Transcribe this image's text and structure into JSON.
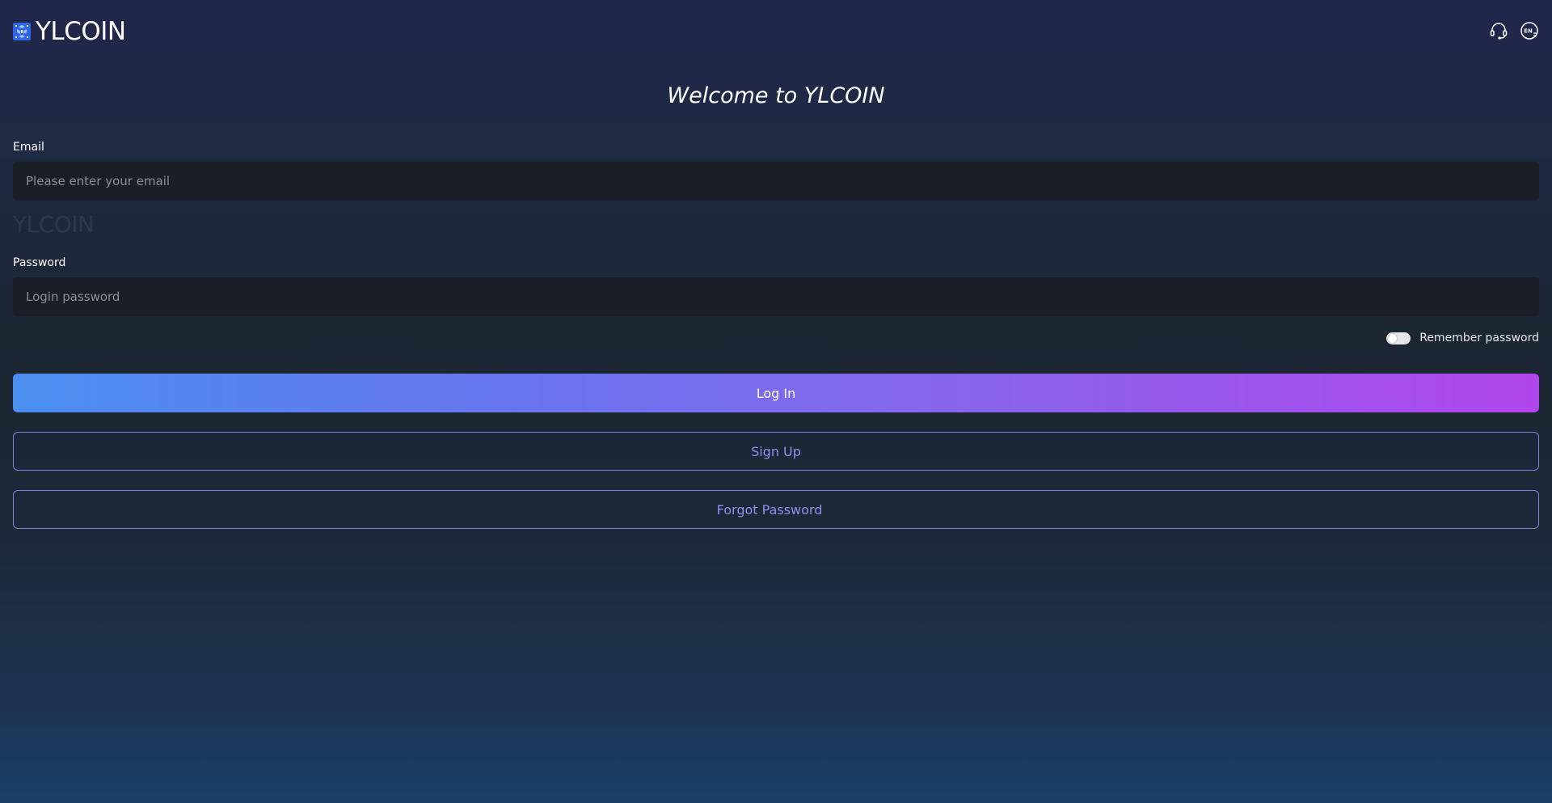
{
  "brand": {
    "name": "YLCOIN",
    "watermark": "YLCOIN"
  },
  "header": {
    "icons": [
      "headset-support-icon",
      "language-en-icon"
    ],
    "language_badge": "EN"
  },
  "welcome": "Welcome to YLCOIN",
  "form": {
    "email": {
      "label": "Email",
      "placeholder": "Please enter your email",
      "value": ""
    },
    "password": {
      "label": "Password",
      "placeholder": "Login password",
      "value": ""
    },
    "remember": {
      "label": "Remember password",
      "checked": false
    }
  },
  "buttons": {
    "login": "Log In",
    "signup": "Sign Up",
    "forgot": "Forgot Password"
  },
  "colors": {
    "accent_start": "#4a8ff0",
    "accent_end": "#b046ec",
    "outline": "#7b82e6"
  }
}
